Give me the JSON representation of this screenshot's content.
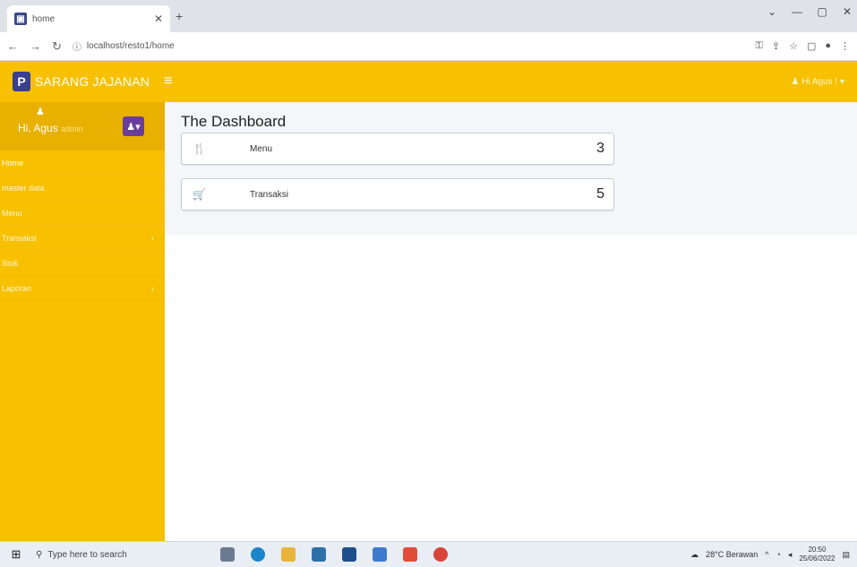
{
  "browser": {
    "tab_title": "home",
    "url": "localhost/resto1/home"
  },
  "header": {
    "brand_letter": "P",
    "brand_name": "SARANG JAJANAN",
    "user_menu": "Hi Agus !"
  },
  "sidebar": {
    "greeting": "Hi, Agus",
    "role": "admin",
    "items": [
      {
        "label": "Home",
        "has_submenu": false
      },
      {
        "label": "master data",
        "has_submenu": false
      },
      {
        "label": "Menu",
        "has_submenu": false
      },
      {
        "label": "Transaksi",
        "has_submenu": true
      },
      {
        "label": "Stok",
        "has_submenu": false
      },
      {
        "label": "Laporan",
        "has_submenu": true
      }
    ]
  },
  "main": {
    "title": "The Dashboard",
    "cards": [
      {
        "icon": "utensils-icon",
        "label": "Menu",
        "value": "3"
      },
      {
        "icon": "cart-icon",
        "label": "Transaksi",
        "value": "5"
      }
    ]
  },
  "taskbar": {
    "search_placeholder": "Type here to search",
    "weather": "28°C Berawan",
    "time": "20:50",
    "date": "25/06/2022"
  },
  "colors": {
    "accent": "#f7c000",
    "brand_logo": "#3a3f8f",
    "user_button": "#6a3d9a",
    "content_bg": "#f4f6f9"
  }
}
